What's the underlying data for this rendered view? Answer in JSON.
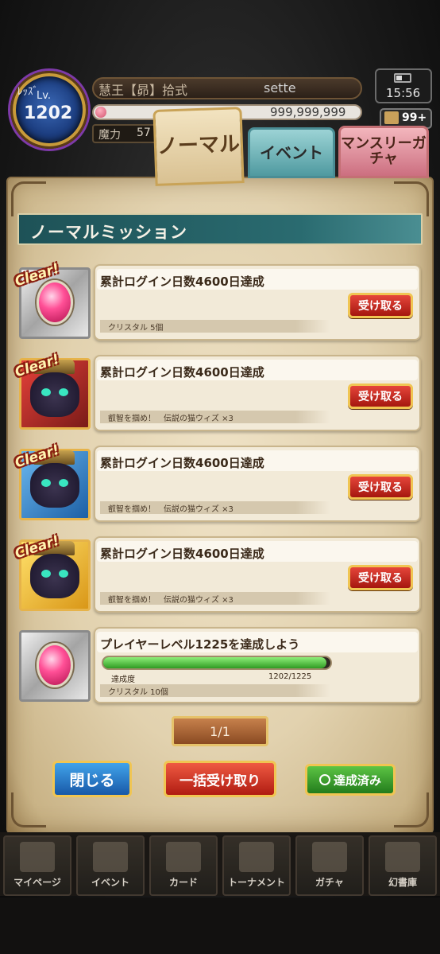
{
  "status": {
    "level_tag": "ﾚｯｽﾞ",
    "level_label": "Lv.",
    "level": "1202",
    "title": "慧王【昴】拾式",
    "username": "sette",
    "gold": "999,999,999",
    "mana_label": "魔力",
    "mana_value": "57",
    "time": "15:56",
    "notifications": "99+"
  },
  "tabs": [
    {
      "label": "ノーマル",
      "active": true
    },
    {
      "label": "イベント",
      "active": false
    },
    {
      "label": "マンスリーガチャ",
      "active": false
    }
  ],
  "section_title": "ノーマルミッション",
  "clear_badge": "Clear!",
  "missions": [
    {
      "title": "累計ログイン日数4600日達成",
      "reward": "クリスタル 5個",
      "button": "受け取る",
      "cleared": true
    },
    {
      "title": "累計ログイン日数4600日達成",
      "reward": "叡智を掴め！　伝説の猫ウィズ ×3",
      "button": "受け取る",
      "cleared": true
    },
    {
      "title": "累計ログイン日数4600日達成",
      "reward": "叡智を掴め！　伝説の猫ウィズ ×3",
      "button": "受け取る",
      "cleared": true
    },
    {
      "title": "累計ログイン日数4600日達成",
      "reward": "叡智を掴め！　伝説の猫ウィズ ×3",
      "button": "受け取る",
      "cleared": true
    },
    {
      "title": "プレイヤーレベル1225を達成しよう",
      "reward": "クリスタル 10個",
      "progress_label": "達成度",
      "progress_value": "1202/1225",
      "progress": 0.981,
      "cleared": false
    }
  ],
  "pager": "1/1",
  "buttons": {
    "close": "閉じる",
    "bulk_receive": "一括受け取り",
    "completed": "達成済み"
  },
  "nav": [
    {
      "label": "マイページ"
    },
    {
      "label": "イベント"
    },
    {
      "label": "カード"
    },
    {
      "label": "トーナメント"
    },
    {
      "label": "ガチャ"
    },
    {
      "label": "幻書庫"
    }
  ]
}
